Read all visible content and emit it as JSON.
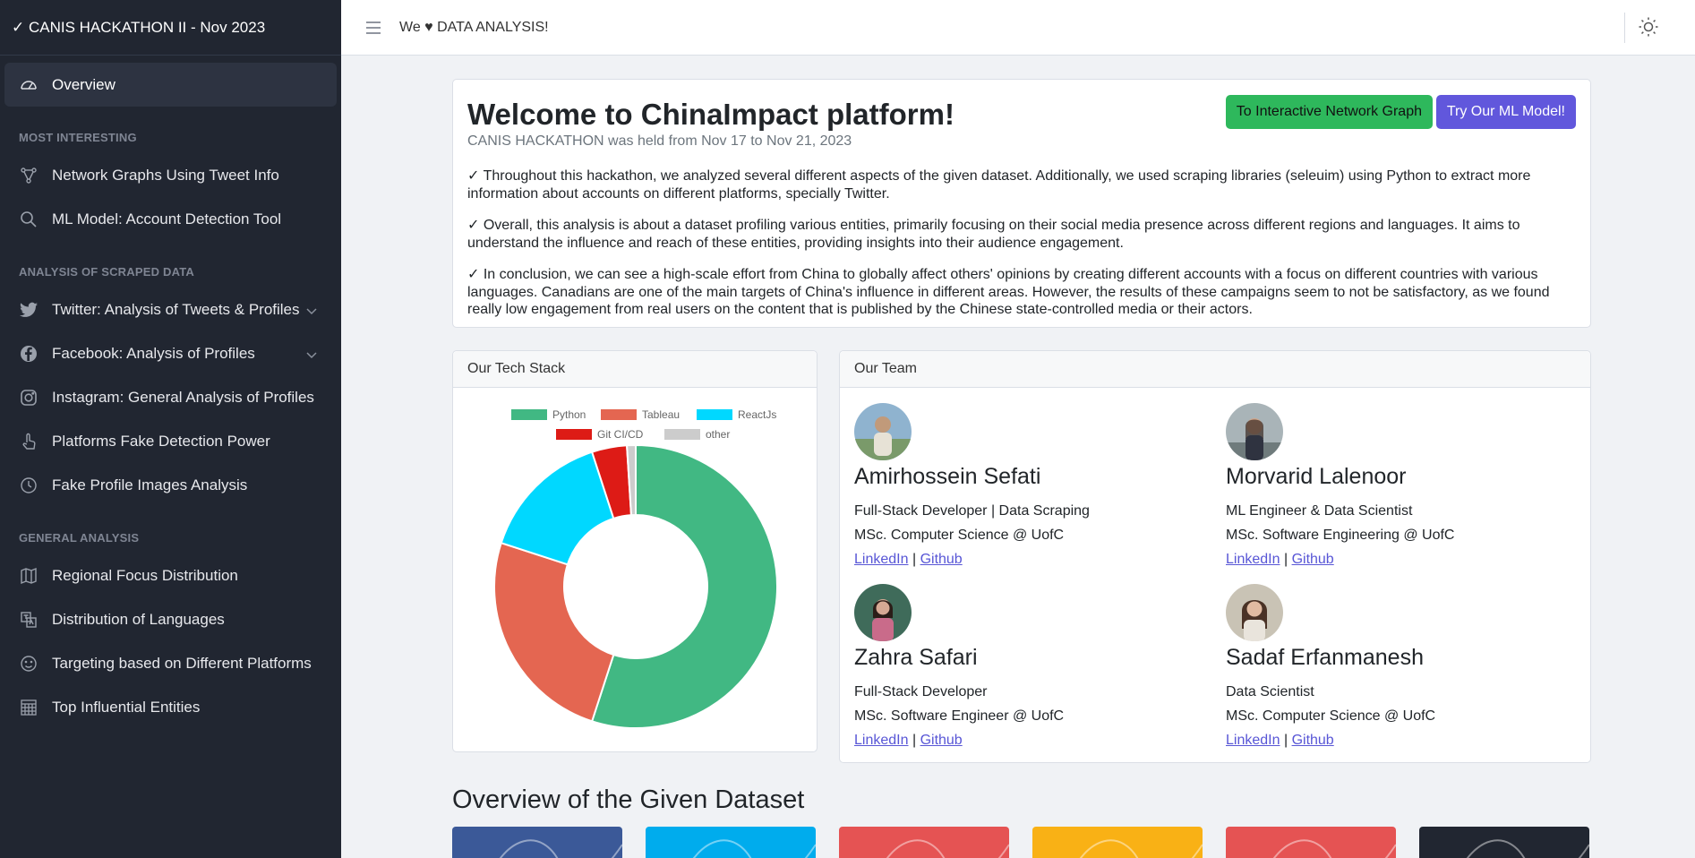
{
  "brand": "✓ CANIS HACKATHON II - Nov 2023",
  "sidebar": {
    "overview": "Overview",
    "section1": "MOST INTERESTING",
    "section2": "ANALYSIS OF SCRAPED DATA",
    "section3": "GENERAL ANALYSIS",
    "items": [
      "Network Graphs Using Tweet Info",
      "ML Model: Account Detection Tool",
      "Twitter: Analysis of Tweets & Profiles",
      "Facebook: Analysis of Profiles",
      "Instagram: General Analysis of Profiles",
      "Platforms Fake Detection Power",
      "Fake Profile Images Analysis",
      "Regional Focus Distribution",
      "Distribution of Languages",
      "Targeting based on Different Platforms",
      "Top Influential Entities"
    ]
  },
  "header": {
    "title": "We ♥ DATA ANALYSIS!"
  },
  "welcome": {
    "title": "Welcome to ChinaImpact platform!",
    "subtitle": "CANIS HACKATHON was held from Nov 17 to Nov 21, 2023",
    "btn_graph": "To Interactive Network Graph",
    "btn_ml": "Try Our ML Model!",
    "p1": "✓ Throughout this hackathon, we analyzed several different aspects of the given dataset. Additionally, we used scraping libraries (seleuim) using Python to extract more information about accounts on different platforms, specially Twitter.",
    "p2": "✓ Overall, this analysis is about a dataset profiling various entities, primarily focusing on their social media presence across different regions and languages. It aims to understand the influence and reach of these entities, providing insights into their audience engagement.",
    "p3": "✓ In conclusion, we can see a high-scale effort from China to globally affect others' opinions by creating different accounts with a focus on different countries with various languages. Canadians are one of the main targets of China's influence in different areas. However, the results of these campaigns seem to not be satisfactory, as we found really low engagement from real users on the content that is published by the Chinese state-controlled media or their actors."
  },
  "tech": {
    "header": "Our Tech Stack"
  },
  "chart_data": {
    "type": "pie",
    "categories": [
      "Python",
      "Tableau",
      "ReactJs",
      "Git CI/CD",
      "other"
    ],
    "values": [
      55,
      25,
      15,
      4,
      1
    ],
    "colors": [
      "#41b883",
      "#e46651",
      "#00d8ff",
      "#dd1b16",
      "#cccccc"
    ],
    "legend": "top"
  },
  "team": {
    "header": "Our Team",
    "members": [
      {
        "name": "Amirhossein Sefati",
        "role": "Full-Stack Developer | Data Scraping",
        "edu": "MSc. Computer Science @ UofC",
        "linkedin": "LinkedIn",
        "sep": "|",
        "github": "Github"
      },
      {
        "name": "Morvarid Lalenoor",
        "role": "ML Engineer & Data Scientist",
        "edu": "MSc. Software Engineering @ UofC",
        "linkedin": "LinkedIn",
        "sep": "|",
        "github": "Github"
      },
      {
        "name": "Zahra Safari",
        "role": "Full-Stack Developer",
        "edu": "MSc. Software Engineer @ UofC",
        "linkedin": "LinkedIn",
        "sep": "|",
        "github": "Github"
      },
      {
        "name": "Sadaf Erfanmanesh",
        "role": "Data Scientist",
        "edu": "MSc. Computer Science @ UofC",
        "linkedin": "LinkedIn",
        "sep": "|",
        "github": "Github"
      }
    ]
  },
  "overview": {
    "title": "Overview of the Given Dataset",
    "tile_colors": [
      "#3b5998",
      "#00aced",
      "#e55353",
      "#f9b115",
      "#e55353",
      "#212631"
    ]
  }
}
